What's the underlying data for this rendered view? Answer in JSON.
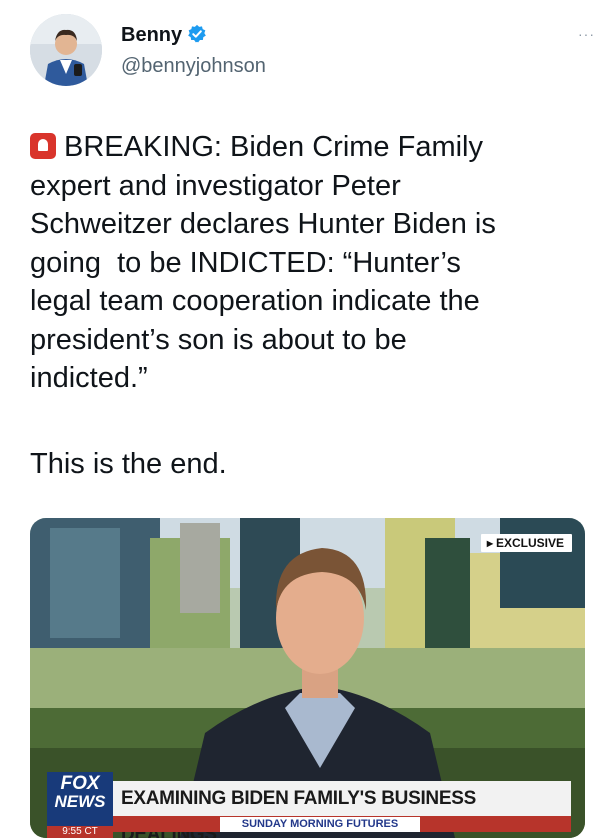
{
  "author": {
    "display_name": "Benny",
    "handle": "@bennyjohnson",
    "verified_icon": "verified-badge-icon",
    "avatar_icon": "profile-photo"
  },
  "menu": {
    "more_label": "···"
  },
  "tweet": {
    "lines": [
      "BREAKING: Biden Crime Family",
      "expert and investigator Peter",
      "Schweitzer declares Hunter Biden is",
      "going  to be INDICTED: “Hunter’s",
      "legal team cooperation indicate the",
      "president’s son is about to be",
      "indicted.”"
    ],
    "closing": "This is the end.",
    "leading_emoji": "siren-emoji"
  },
  "media": {
    "badge": "EXCLUSIVE",
    "network_line1": "FOX",
    "network_line2": "NEWS",
    "time": "9:55 CT",
    "headline": "EXAMINING BIDEN FAMILY'S BUSINESS DEALINGS",
    "show": "SUNDAY MORNING FUTURES"
  },
  "colors": {
    "accent_verified": "#1d9bf0",
    "fox_blue": "#183a7a",
    "fox_red": "#b7342b"
  }
}
